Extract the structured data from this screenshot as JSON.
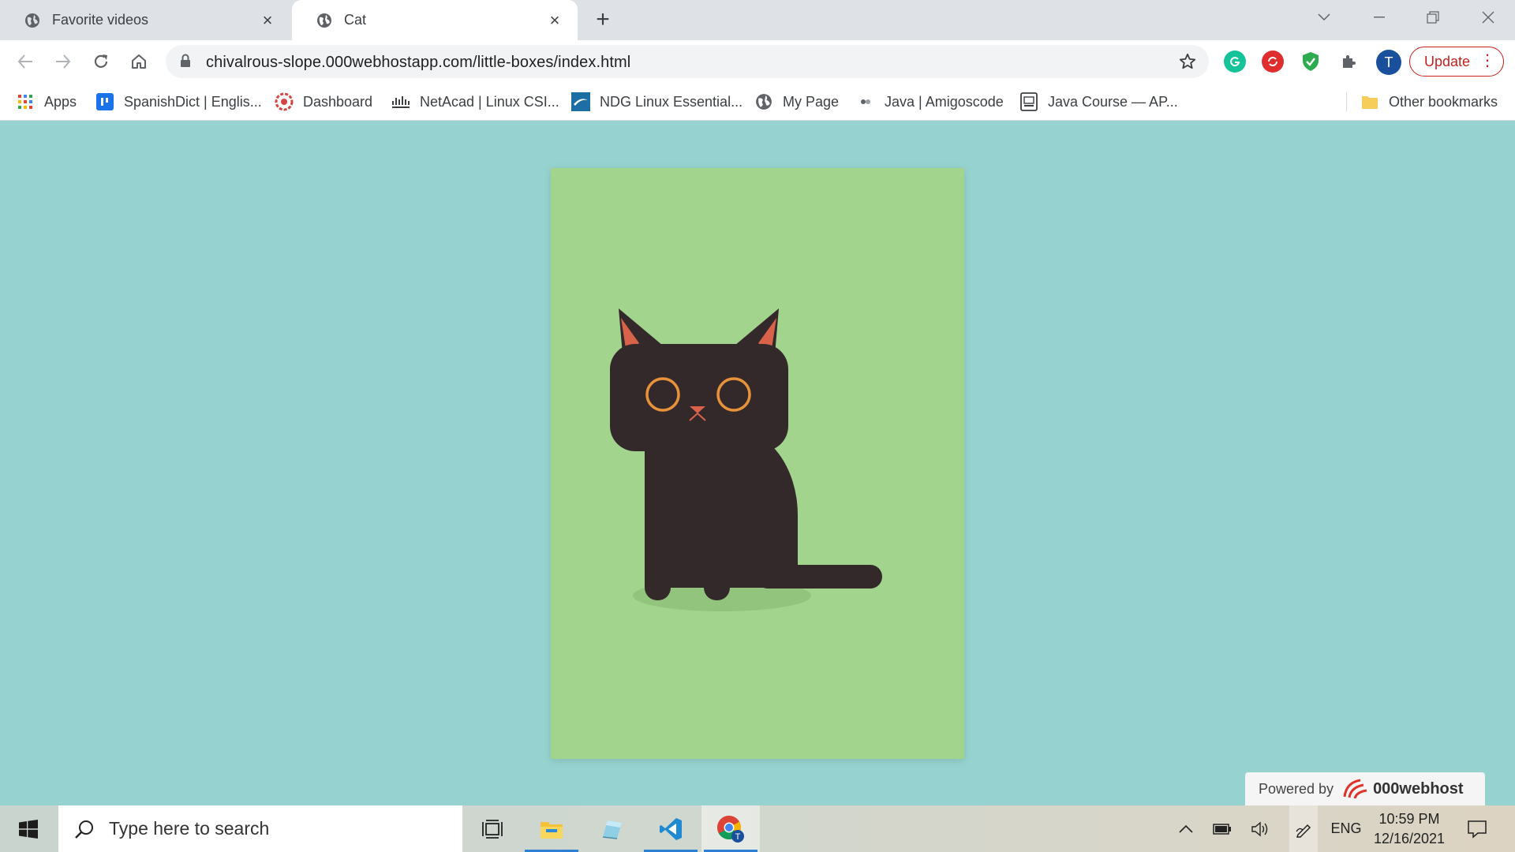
{
  "browser": {
    "tabs": [
      {
        "title": "Favorite videos",
        "icon": "globe-icon",
        "active": false
      },
      {
        "title": "Cat",
        "icon": "globe-icon",
        "active": true
      }
    ],
    "new_tab_symbol": "+",
    "url": "chivalrous-slope.000webhostapp.com/little-boxes/index.html",
    "avatar_letter": "T",
    "update_label": "Update",
    "update_menu_symbol": "⋮"
  },
  "bookmarks": {
    "items": [
      {
        "label": "Apps",
        "icon": "apps-grid-icon"
      },
      {
        "label": "SpanishDict | Englis...",
        "icon": "spanishdict-icon"
      },
      {
        "label": "Dashboard",
        "icon": "dashboard-icon"
      },
      {
        "label": "NetAcad | Linux CSI...",
        "icon": "cisco-icon"
      },
      {
        "label": "NDG Linux Essential...",
        "icon": "ndg-icon"
      },
      {
        "label": "My Page",
        "icon": "globe-icon"
      },
      {
        "label": "Java | Amigoscode",
        "icon": "amigoscode-icon"
      },
      {
        "label": "Java Course — AP...",
        "icon": "document-icon"
      }
    ],
    "other_label": "Other bookmarks"
  },
  "page": {
    "powered_by_label": "Powered by",
    "powered_by_brand": "000webhost",
    "colors": {
      "background": "#96d3d0",
      "card": "#a3d48e",
      "cat_body": "#33292a",
      "cat_ear_inner": "#d9624a",
      "cat_eye": "#e8923a"
    }
  },
  "taskbar": {
    "search_placeholder": "Type here to search",
    "language": "ENG",
    "time": "10:59 PM",
    "date": "12/16/2021"
  }
}
